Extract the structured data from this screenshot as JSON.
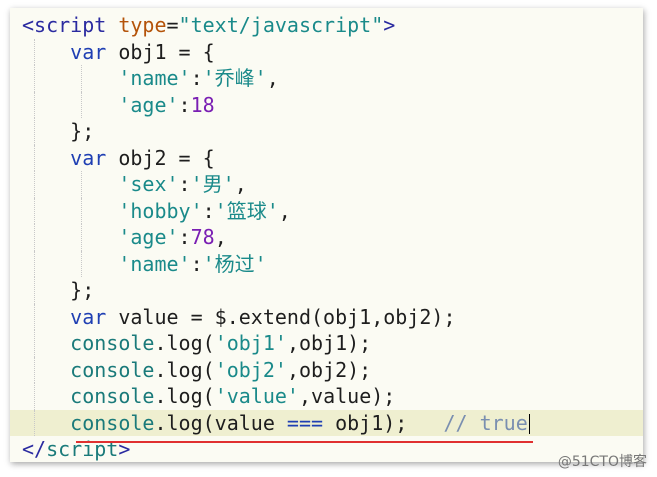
{
  "code": {
    "lines": [
      [
        {
          "t": "<script ",
          "c": "tag"
        },
        {
          "t": "type",
          "c": "attr"
        },
        {
          "t": "=",
          "c": "plain"
        },
        {
          "t": "\"text/javascript\"",
          "c": "str"
        },
        {
          "t": ">",
          "c": "tag"
        }
      ],
      [
        {
          "t": "    ",
          "c": "plain"
        },
        {
          "t": "var",
          "c": "kw"
        },
        {
          "t": " obj1 = {",
          "c": "plain"
        }
      ],
      [
        {
          "t": "        ",
          "c": "plain"
        },
        {
          "t": "'name'",
          "c": "str"
        },
        {
          "t": ":",
          "c": "plain"
        },
        {
          "t": "'乔峰'",
          "c": "str"
        },
        {
          "t": ",",
          "c": "plain"
        }
      ],
      [
        {
          "t": "        ",
          "c": "plain"
        },
        {
          "t": "'age'",
          "c": "str"
        },
        {
          "t": ":",
          "c": "plain"
        },
        {
          "t": "18",
          "c": "num"
        }
      ],
      [
        {
          "t": "    };",
          "c": "plain"
        }
      ],
      [
        {
          "t": "    ",
          "c": "plain"
        },
        {
          "t": "var",
          "c": "kw"
        },
        {
          "t": " obj2 = {",
          "c": "plain"
        }
      ],
      [
        {
          "t": "        ",
          "c": "plain"
        },
        {
          "t": "'sex'",
          "c": "str"
        },
        {
          "t": ":",
          "c": "plain"
        },
        {
          "t": "'男'",
          "c": "str"
        },
        {
          "t": ",",
          "c": "plain"
        }
      ],
      [
        {
          "t": "        ",
          "c": "plain"
        },
        {
          "t": "'hobby'",
          "c": "str"
        },
        {
          "t": ":",
          "c": "plain"
        },
        {
          "t": "'篮球'",
          "c": "str"
        },
        {
          "t": ",",
          "c": "plain"
        }
      ],
      [
        {
          "t": "        ",
          "c": "plain"
        },
        {
          "t": "'age'",
          "c": "str"
        },
        {
          "t": ":",
          "c": "plain"
        },
        {
          "t": "78",
          "c": "num"
        },
        {
          "t": ",",
          "c": "plain"
        }
      ],
      [
        {
          "t": "        ",
          "c": "plain"
        },
        {
          "t": "'name'",
          "c": "str"
        },
        {
          "t": ":",
          "c": "plain"
        },
        {
          "t": "'杨过'",
          "c": "str"
        }
      ],
      [
        {
          "t": "    };",
          "c": "plain"
        }
      ],
      [
        {
          "t": "    ",
          "c": "plain"
        },
        {
          "t": "var",
          "c": "kw"
        },
        {
          "t": " value = $.extend(obj1,obj2);",
          "c": "plain"
        }
      ],
      [
        {
          "t": "    ",
          "c": "plain"
        },
        {
          "t": "console",
          "c": "fn"
        },
        {
          "t": ".log(",
          "c": "plain"
        },
        {
          "t": "'obj1'",
          "c": "str"
        },
        {
          "t": ",obj1);",
          "c": "plain"
        }
      ],
      [
        {
          "t": "    ",
          "c": "plain"
        },
        {
          "t": "console",
          "c": "fn"
        },
        {
          "t": ".log(",
          "c": "plain"
        },
        {
          "t": "'obj2'",
          "c": "str"
        },
        {
          "t": ",obj2);",
          "c": "plain"
        }
      ],
      [
        {
          "t": "    ",
          "c": "plain"
        },
        {
          "t": "console",
          "c": "fn"
        },
        {
          "t": ".log(",
          "c": "plain"
        },
        {
          "t": "'value'",
          "c": "str"
        },
        {
          "t": ",value);",
          "c": "plain"
        }
      ],
      [
        {
          "t": "    ",
          "c": "plain"
        },
        {
          "t": "console",
          "c": "fn"
        },
        {
          "t": ".log(value ",
          "c": "plain"
        },
        {
          "t": "===",
          "c": "kw"
        },
        {
          "t": " obj1);   ",
          "c": "plain"
        },
        {
          "t": "// true",
          "c": "cm"
        }
      ],
      [
        {
          "t": "</",
          "c": "tag"
        },
        {
          "t": "script",
          "c": "fn"
        },
        {
          "t": ">",
          "c": "tag"
        }
      ]
    ],
    "current_line": 15
  },
  "watermark": "@51CTO博客",
  "colors": {
    "background": "#fbfbf3",
    "current_line": "#efefd0",
    "underline": "#e03030"
  }
}
